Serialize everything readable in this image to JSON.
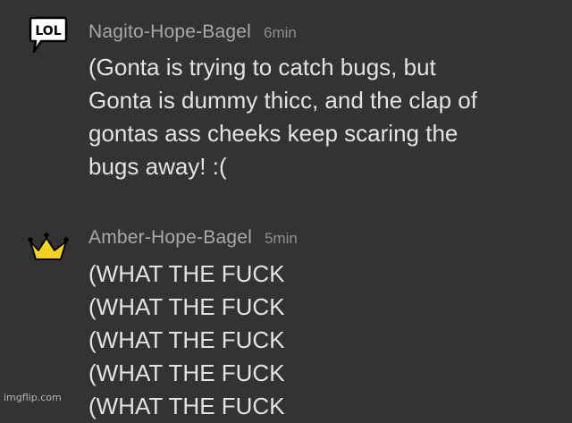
{
  "comments": [
    {
      "avatar_icon": "lol-speech-bubble-icon",
      "avatar_text": "LOL",
      "username": "Nagito-Hope-Bagel",
      "time": "6min",
      "lines": [
        "(Gonta is trying to catch bugs, but",
        "Gonta is dummy thicc, and the clap of",
        "gontas ass cheeks keep scaring the",
        "bugs away! :("
      ]
    },
    {
      "avatar_icon": "crown-icon",
      "username": "Amber-Hope-Bagel",
      "time": "5min",
      "lines": [
        "(WHAT THE FUCK",
        "(WHAT THE FUCK",
        "(WHAT THE FUCK",
        "(WHAT THE FUCK",
        "(WHAT THE FUCK"
      ]
    }
  ],
  "watermark": "imgflip.com",
  "colors": {
    "background": "#333333",
    "username": "#a9a9a9",
    "body_text": "#e3e3e3",
    "crown": "#f5d21f"
  }
}
